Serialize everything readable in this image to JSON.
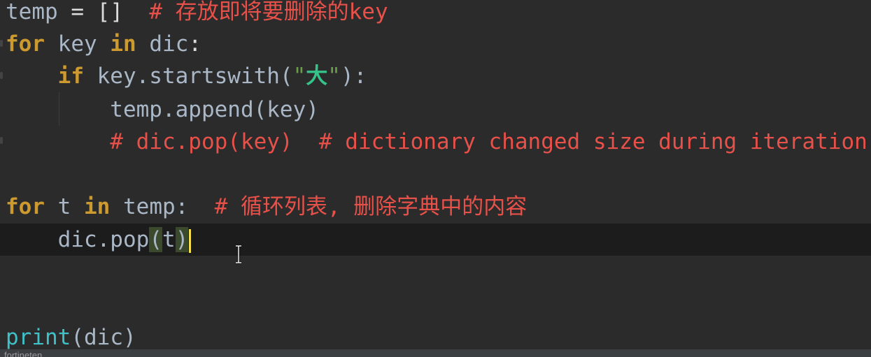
{
  "editor": {
    "lines": {
      "l1": {
        "t1": "temp",
        "t2": " = ",
        "t3": "[]",
        "t4": "  # 存放即将要删除的key"
      },
      "l2": {
        "t1": "for",
        "t2": " key ",
        "t3": "in",
        "t4": " dic",
        "t5": ":"
      },
      "l3": {
        "t1": "    ",
        "t2": "if",
        "t3": " key.startswith(",
        "t4": "\"",
        "t5": "大",
        "t6": "\"",
        "t7": "):"
      },
      "l4": {
        "t1": "        temp.append(key)"
      },
      "l5": {
        "t1": "        # dic.pop(key)  # dictionary changed size during iteration"
      },
      "l7": {
        "t1": "for",
        "t2": " t ",
        "t3": "in",
        "t4": " temp:",
        "t5": "  # 循环列表, 删除字典中的内容"
      },
      "l8": {
        "t1": "    dic.pop",
        "t2": "(",
        "t3": "t",
        "t4": ")"
      },
      "l12": {
        "t1": "print",
        "t2": "(dic)"
      }
    },
    "colors": {
      "background": "#2b2b2b",
      "current_line": "#1c1c1c",
      "keyword": "#cc9a2e",
      "comment": "#e8514a",
      "string": "#34c48a",
      "builtin": "#3fc1c9",
      "caret": "#f5e04a"
    },
    "cursor_icon": "text-ibeam-icon"
  },
  "status": {
    "partial_text": "fortineten"
  }
}
